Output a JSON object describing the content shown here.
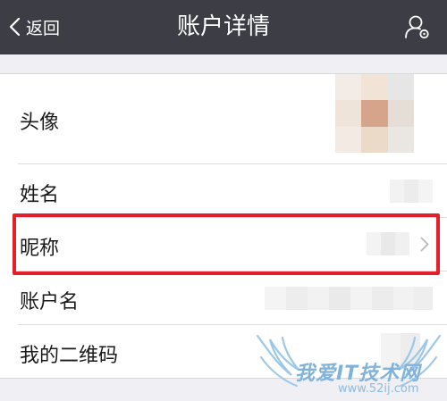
{
  "navbar": {
    "back_label": "返回",
    "title": "账户详情"
  },
  "rows": {
    "avatar": {
      "label": "头像"
    },
    "name": {
      "label": "姓名"
    },
    "nickname": {
      "label": "昵称"
    },
    "account": {
      "label": "账户名"
    },
    "qrcode": {
      "label": "我的二维码"
    }
  },
  "watermark": {
    "text": "我爱IT技术网",
    "url": "www.52ij.com"
  },
  "colors": {
    "navbar_bg": "#3d3d46",
    "page_bg": "#efeff4",
    "highlight": "#e3202a"
  },
  "icons": {
    "back": "chevron-left-icon",
    "user": "user-settings-icon",
    "row_arrow": "chevron-right-icon"
  }
}
